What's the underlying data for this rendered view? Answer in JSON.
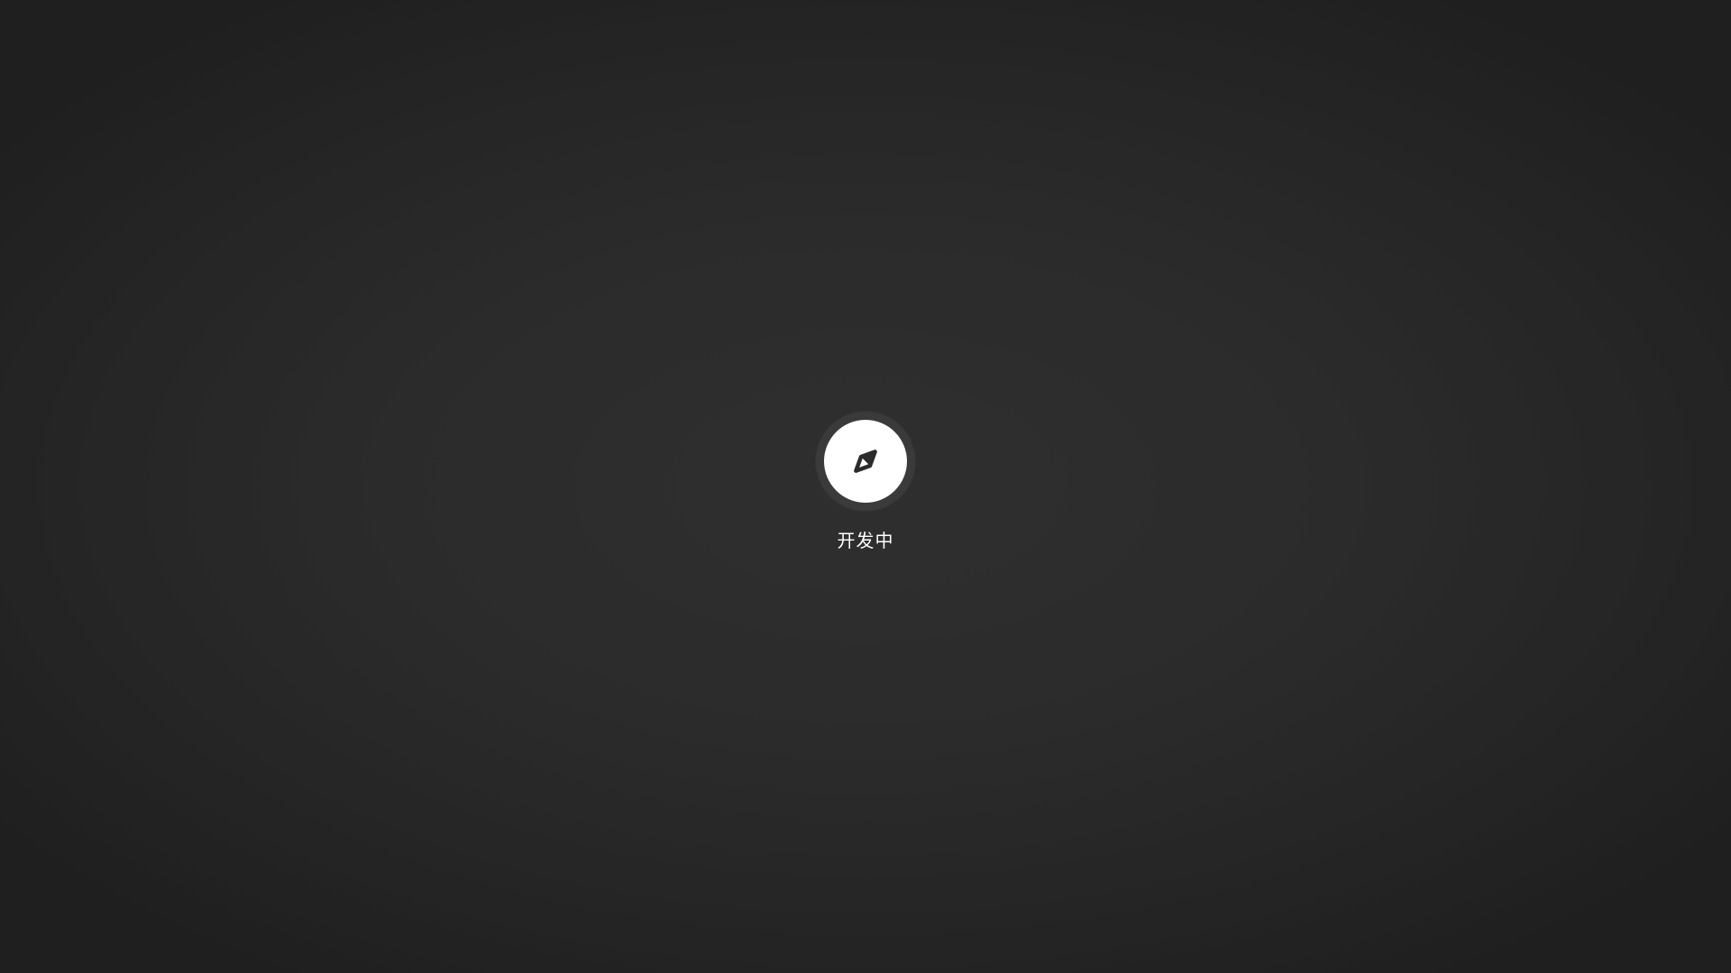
{
  "status": {
    "label": "开发中",
    "icon": "compass-icon"
  },
  "colors": {
    "background_center": "#2f2f2f",
    "background_edge": "#1f1f1f",
    "icon_disc": "#ffffff",
    "icon_glyph": "#2b2b2b",
    "label_text": "#ffffff"
  }
}
